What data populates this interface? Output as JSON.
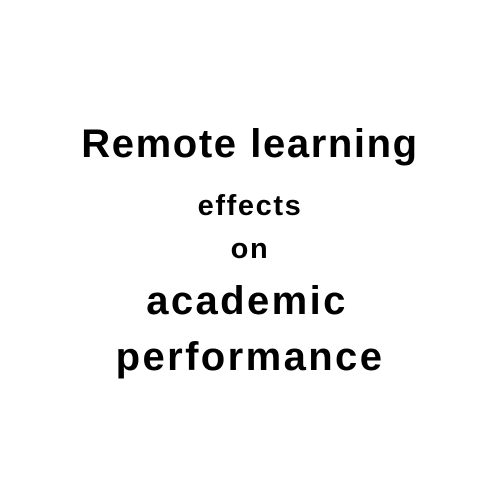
{
  "title_lines": [
    "Remote learning",
    "effects",
    "on",
    "academic",
    "performance"
  ]
}
